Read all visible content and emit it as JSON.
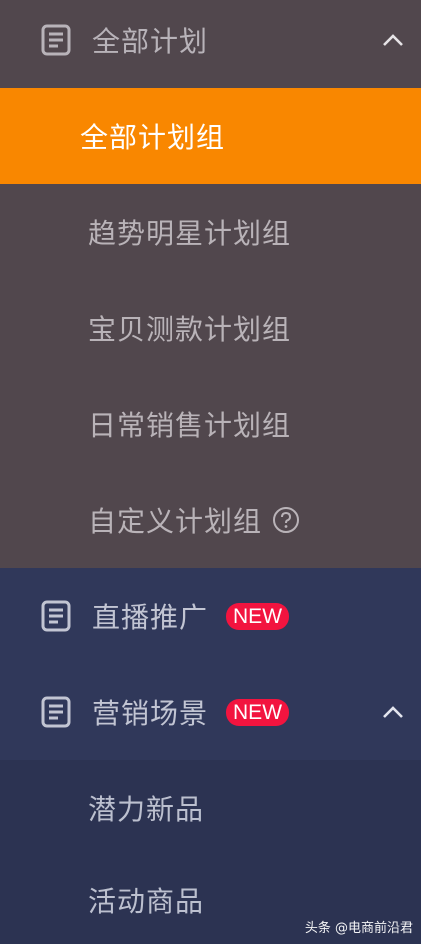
{
  "sections": {
    "all_plans": {
      "label": "全部计划",
      "icon": "document-icon",
      "expanded": true,
      "items": [
        {
          "label": "全部计划组",
          "active": true
        },
        {
          "label": "趋势明星计划组",
          "active": false
        },
        {
          "label": "宝贝测款计划组",
          "active": false
        },
        {
          "label": "日常销售计划组",
          "active": false
        },
        {
          "label": "自定义计划组",
          "active": false,
          "help_icon": "question-circle-icon"
        }
      ]
    },
    "live_promotion": {
      "label": "直播推广",
      "icon": "document-icon",
      "badge": "NEW"
    },
    "marketing_scenes": {
      "label": "营销场景",
      "icon": "document-icon",
      "badge": "NEW",
      "expanded": true,
      "items": [
        {
          "label": "潜力新品"
        },
        {
          "label": "活动商品"
        }
      ]
    }
  },
  "watermark": "头条 @电商前沿君",
  "colors": {
    "sidebar_brown": "#51474d",
    "sidebar_navy": "#30385a",
    "active_orange": "#f98700",
    "badge_red": "#f2143f"
  }
}
